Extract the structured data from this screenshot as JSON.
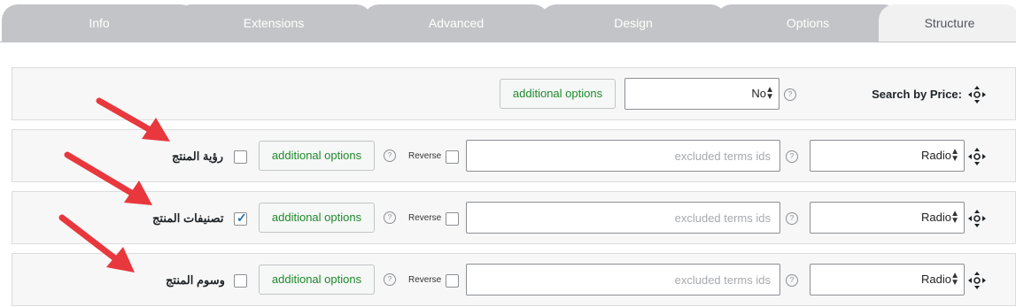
{
  "tabs": [
    {
      "label": "Info",
      "active": false
    },
    {
      "label": "Extensions",
      "active": false
    },
    {
      "label": "Advanced",
      "active": false
    },
    {
      "label": "Design",
      "active": false
    },
    {
      "label": "Options",
      "active": false
    },
    {
      "label": "Structure",
      "active": true
    }
  ],
  "price_row": {
    "label": ":Search by Price",
    "select_value": "No",
    "button": "additional options"
  },
  "filter_rows": [
    {
      "label": "رؤية المنتج",
      "checked": false,
      "button": "additional options",
      "reverse_label": "Reverse",
      "excluded_placeholder": "excluded terms ids",
      "select_value": "Radio"
    },
    {
      "label": "تصنيفات المنتج",
      "checked": true,
      "button": "additional options",
      "reverse_label": "Reverse",
      "excluded_placeholder": "excluded terms ids",
      "select_value": "Radio"
    },
    {
      "label": "وسوم المنتج",
      "checked": false,
      "button": "additional options",
      "reverse_label": "Reverse",
      "excluded_placeholder": "excluded terms ids",
      "select_value": "Radio"
    }
  ],
  "help_glyph": "?",
  "icons": {
    "move": "move-arrows-icon",
    "help": "question-circle-icon",
    "annotation": "red-arrow-icon"
  },
  "colors": {
    "annotation_arrow": "#e8383d",
    "button_text": "#1f8a2a",
    "tab_inactive": "#c3c4c7",
    "checkbox_tick": "#2271b1"
  }
}
